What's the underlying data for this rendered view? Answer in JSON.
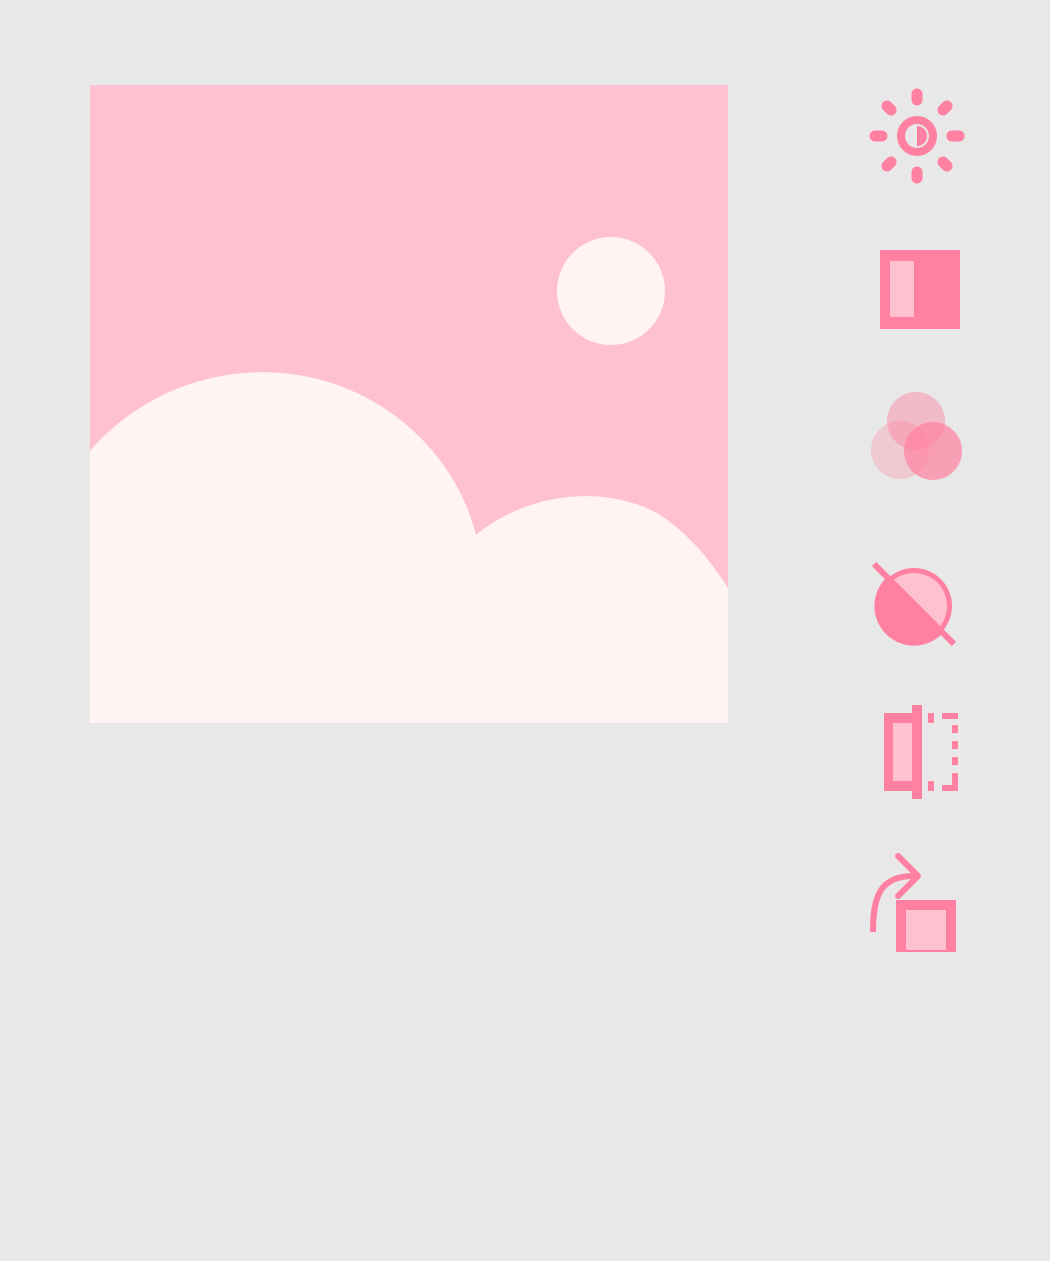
{
  "colors": {
    "background": "#e8e8e8",
    "sky": "#ffc1d0",
    "cloud": "#fff4f3",
    "accent": "#ff80a0",
    "accent_light": "#f5a6bb"
  },
  "canvas": {
    "icon": "image-placeholder"
  },
  "toolbar": {
    "tools": [
      {
        "icon": "brightness-icon"
      },
      {
        "icon": "contrast-icon"
      },
      {
        "icon": "color-channels-icon"
      },
      {
        "icon": "invert-icon"
      },
      {
        "icon": "flip-horizontal-icon"
      },
      {
        "icon": "rotate-icon"
      }
    ]
  }
}
